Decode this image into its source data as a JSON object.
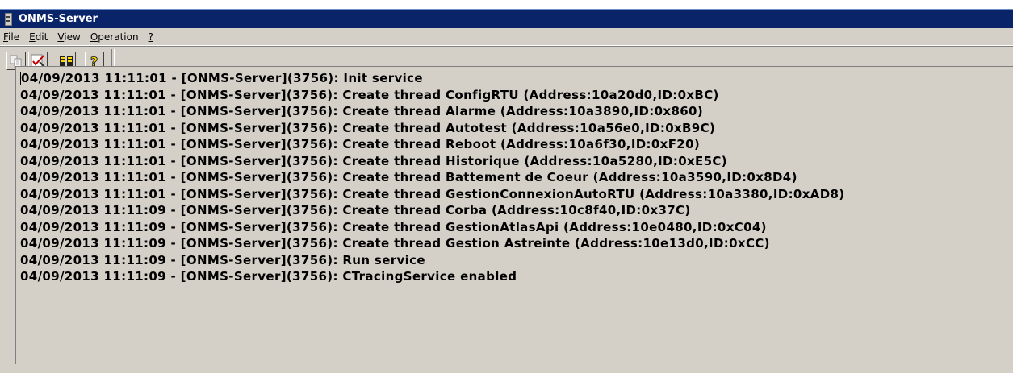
{
  "window": {
    "title": "ONMS-Server",
    "title_bar_color": "#0a246a",
    "background_color": "#d4d0c8"
  },
  "menu": {
    "items": [
      {
        "label": "File",
        "mnemonic": "F",
        "rest": "ile"
      },
      {
        "label": "Edit",
        "mnemonic": "E",
        "rest": "dit"
      },
      {
        "label": "View",
        "mnemonic": "V",
        "rest": "iew"
      },
      {
        "label": "Operation",
        "mnemonic": "O",
        "rest": "peration"
      },
      {
        "label": "?",
        "mnemonic": "?",
        "rest": ""
      }
    ]
  },
  "toolbar": {
    "buttons": [
      {
        "icon": "copy-icon"
      },
      {
        "icon": "clear-icon"
      },
      {
        "icon": "info-icon"
      },
      {
        "icon": "help-icon"
      }
    ]
  },
  "log": {
    "lines": [
      "04/09/2013 11:11:01 - [ONMS-Server](3756): Init service",
      "04/09/2013 11:11:01 - [ONMS-Server](3756): Create thread ConfigRTU (Address:10a20d0,ID:0xBC)",
      "04/09/2013 11:11:01 - [ONMS-Server](3756): Create thread Alarme (Address:10a3890,ID:0x860)",
      "04/09/2013 11:11:01 - [ONMS-Server](3756): Create thread Autotest (Address:10a56e0,ID:0xB9C)",
      "04/09/2013 11:11:01 - [ONMS-Server](3756): Create thread Reboot (Address:10a6f30,ID:0xF20)",
      "04/09/2013 11:11:01 - [ONMS-Server](3756): Create thread Historique (Address:10a5280,ID:0xE5C)",
      "04/09/2013 11:11:01 - [ONMS-Server](3756): Create thread Battement de Coeur (Address:10a3590,ID:0x8D4)",
      "04/09/2013 11:11:01 - [ONMS-Server](3756): Create thread GestionConnexionAutoRTU (Address:10a3380,ID:0xAD8)",
      "04/09/2013 11:11:09 - [ONMS-Server](3756): Create thread Corba (Address:10c8f40,ID:0x37C)",
      "04/09/2013 11:11:09 - [ONMS-Server](3756): Create thread GestionAtlasApi (Address:10e0480,ID:0xC04)",
      "04/09/2013 11:11:09 - [ONMS-Server](3756): Create thread Gestion Astreinte (Address:10e13d0,ID:0xCC)",
      "04/09/2013 11:11:09 - [ONMS-Server](3756): Run service",
      "04/09/2013 11:11:09 - [ONMS-Server](3756): CTracingService enabled"
    ]
  }
}
